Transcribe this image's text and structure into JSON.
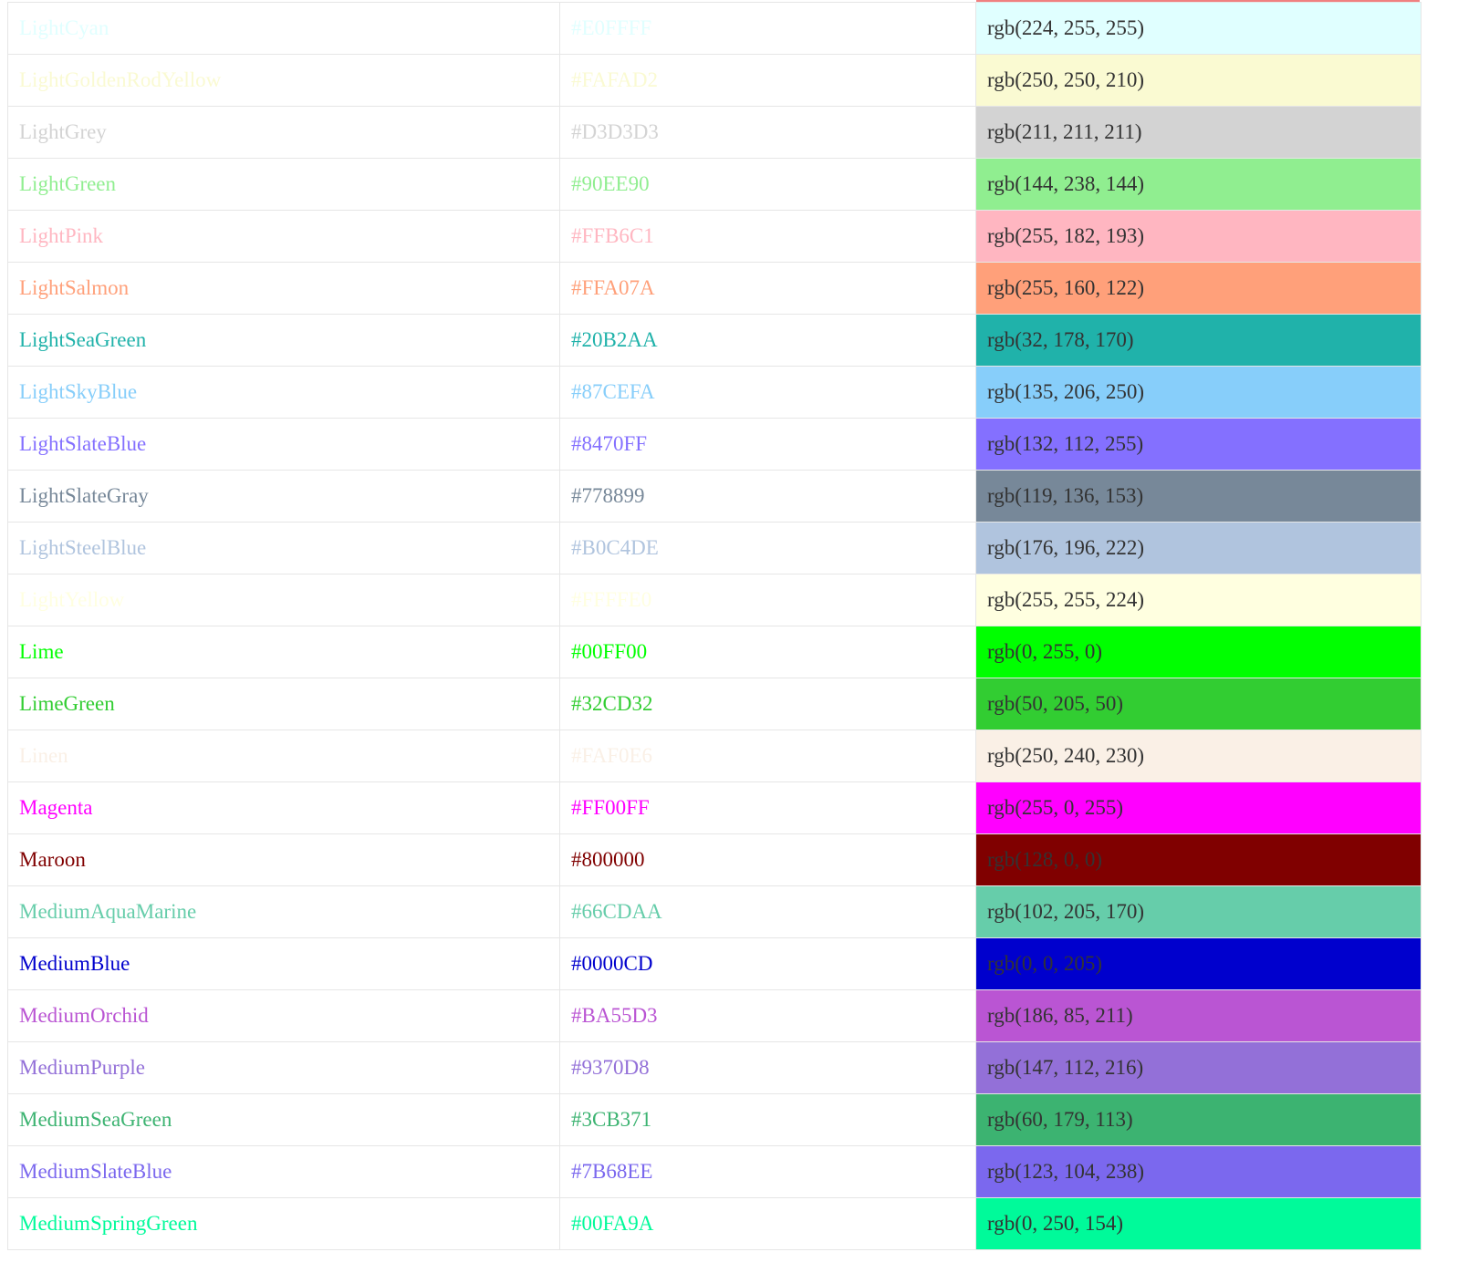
{
  "table": {
    "rows": [
      {
        "name": "LightCyan",
        "hex": "#E0FFFF",
        "rgb": "rgb(224, 255, 255)"
      },
      {
        "name": "LightGoldenRodYellow",
        "hex": "#FAFAD2",
        "rgb": "rgb(250, 250, 210)"
      },
      {
        "name": "LightGrey",
        "hex": "#D3D3D3",
        "rgb": "rgb(211, 211, 211)"
      },
      {
        "name": "LightGreen",
        "hex": "#90EE90",
        "rgb": "rgb(144, 238, 144)"
      },
      {
        "name": "LightPink",
        "hex": "#FFB6C1",
        "rgb": "rgb(255, 182, 193)"
      },
      {
        "name": "LightSalmon",
        "hex": "#FFA07A",
        "rgb": "rgb(255, 160, 122)"
      },
      {
        "name": "LightSeaGreen",
        "hex": "#20B2AA",
        "rgb": "rgb(32, 178, 170)"
      },
      {
        "name": "LightSkyBlue",
        "hex": "#87CEFA",
        "rgb": "rgb(135, 206, 250)"
      },
      {
        "name": "LightSlateBlue",
        "hex": "#8470FF",
        "rgb": "rgb(132, 112, 255)"
      },
      {
        "name": "LightSlateGray",
        "hex": "#778899",
        "rgb": "rgb(119, 136, 153)"
      },
      {
        "name": "LightSteelBlue",
        "hex": "#B0C4DE",
        "rgb": "rgb(176, 196, 222)"
      },
      {
        "name": "LightYellow",
        "hex": "#FFFFE0",
        "rgb": "rgb(255, 255, 224)"
      },
      {
        "name": "Lime",
        "hex": "#00FF00",
        "rgb": "rgb(0, 255, 0)"
      },
      {
        "name": "LimeGreen",
        "hex": "#32CD32",
        "rgb": "rgb(50, 205, 50)"
      },
      {
        "name": "Linen",
        "hex": "#FAF0E6",
        "rgb": "rgb(250, 240, 230)"
      },
      {
        "name": "Magenta",
        "hex": "#FF00FF",
        "rgb": "rgb(255, 0, 255)"
      },
      {
        "name": "Maroon",
        "hex": "#800000",
        "rgb": "rgb(128, 0, 0)"
      },
      {
        "name": "MediumAquaMarine",
        "hex": "#66CDAA",
        "rgb": "rgb(102, 205, 170)"
      },
      {
        "name": "MediumBlue",
        "hex": "#0000CD",
        "rgb": "rgb(0, 0, 205)"
      },
      {
        "name": "MediumOrchid",
        "hex": "#BA55D3",
        "rgb": "rgb(186, 85, 211)"
      },
      {
        "name": "MediumPurple",
        "hex": "#9370D8",
        "rgb": "rgb(147, 112, 216)"
      },
      {
        "name": "MediumSeaGreen",
        "hex": "#3CB371",
        "rgb": "rgb(60, 179, 113)"
      },
      {
        "name": "MediumSlateBlue",
        "hex": "#7B68EE",
        "rgb": "rgb(123, 104, 238)"
      },
      {
        "name": "MediumSpringGreen",
        "hex": "#00FA9A",
        "rgb": "rgb(0, 250, 154)"
      }
    ]
  }
}
